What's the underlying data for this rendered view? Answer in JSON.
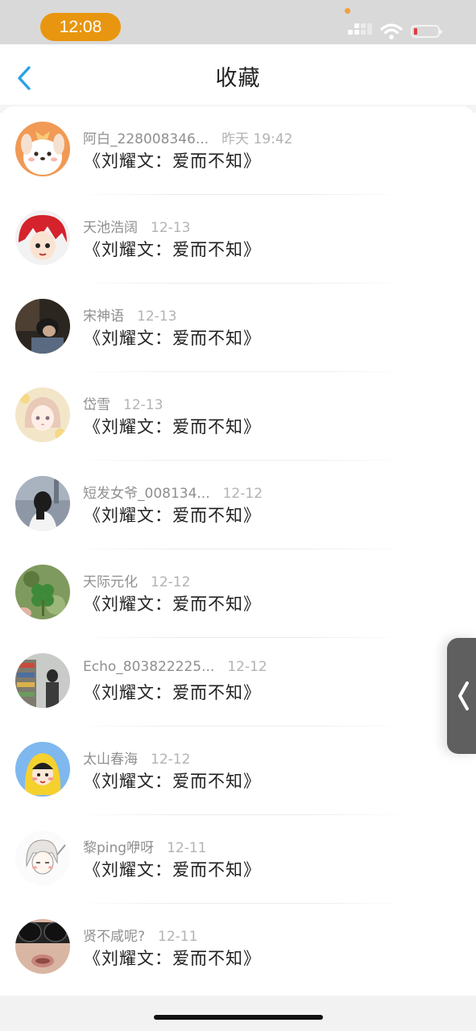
{
  "status_bar": {
    "time": "12:08",
    "time_pill_color": "#e8960f",
    "icons": [
      "signal-icon",
      "wifi-icon",
      "battery-low-icon"
    ]
  },
  "header": {
    "title": "收藏",
    "back_icon": "chevron-left-icon",
    "accent_color": "#2aa2e8"
  },
  "items": [
    {
      "name": "阿白_228008346...",
      "time": "昨天 19:42",
      "title": "《刘耀文：爱而不知》",
      "avatar": "cartoon-dog-avatar"
    },
    {
      "name": "天池浩阔",
      "time": "12-13",
      "title": "《刘耀文：爱而不知》",
      "avatar": "red-hair-anime-avatar"
    },
    {
      "name": "宋神语",
      "time": "12-13",
      "title": "《刘耀文：爱而不知》",
      "avatar": "dark-photo-avatar"
    },
    {
      "name": "岱雪",
      "time": "12-13",
      "title": "《刘耀文：爱而不知》",
      "avatar": "pastel-anime-avatar"
    },
    {
      "name": "短发女爷_008134...",
      "time": "12-12",
      "title": "《刘耀文：爱而不知》",
      "avatar": "girl-photo-avatar"
    },
    {
      "name": "天际元化",
      "time": "12-12",
      "title": "《刘耀文：爱而不知》",
      "avatar": "clover-avatar"
    },
    {
      "name": "Echo_803822225...",
      "time": "12-12",
      "title": "《刘耀文：爱而不知》",
      "avatar": "store-photo-avatar"
    },
    {
      "name": "太山春海",
      "time": "12-12",
      "title": "《刘耀文：爱而不知》",
      "avatar": "yellow-raincoat-avatar"
    },
    {
      "name": "黎ping咿呀",
      "time": "12-11",
      "title": "《刘耀文：爱而不知》",
      "avatar": "sketch-girl-avatar"
    },
    {
      "name": "贤不咸呢?",
      "time": "12-11",
      "title": "《刘耀文：爱而不知》",
      "avatar": "sunglasses-avatar"
    }
  ],
  "side_handle": {
    "icon": "chevron-left-icon"
  }
}
